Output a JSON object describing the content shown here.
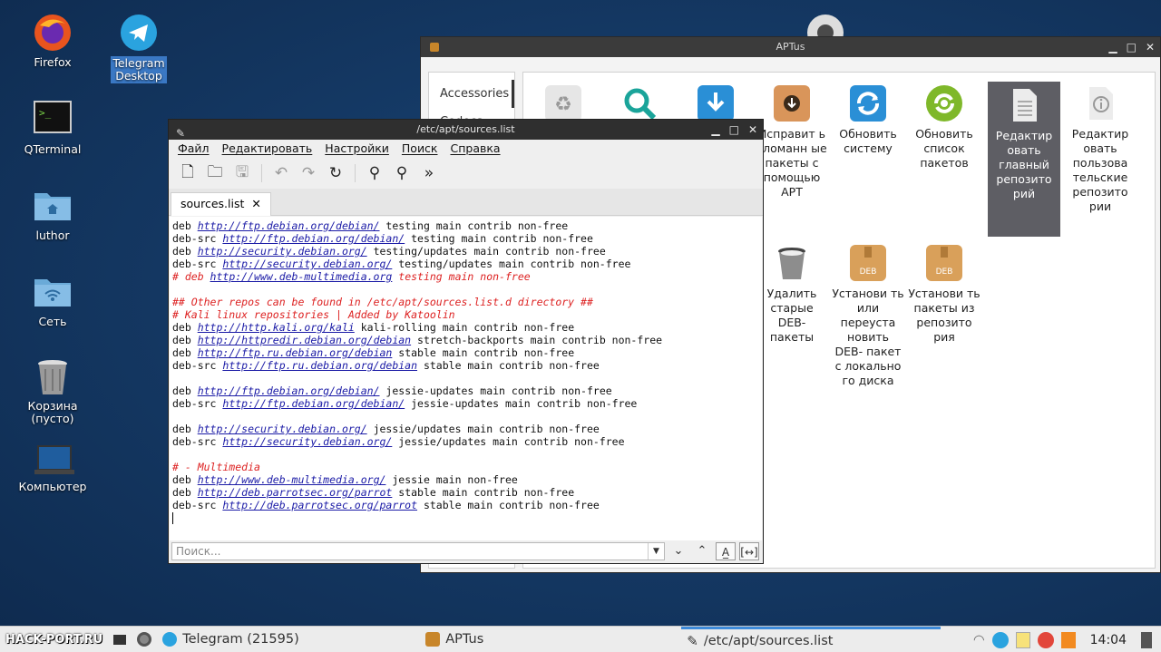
{
  "desktop": {
    "icons": [
      {
        "label": "Firefox"
      },
      {
        "label": "Telegram\nDesktop"
      },
      {
        "label": "QTerminal"
      },
      {
        "label": "luthor"
      },
      {
        "label": "Сеть"
      },
      {
        "label": "Корзина\n(пусто)"
      },
      {
        "label": "Компьютер"
      }
    ],
    "watermark": "HACK-PORT.RU"
  },
  "aptus": {
    "title": "APTus",
    "categories": [
      "Accessories",
      "Codecs"
    ],
    "apps": [
      {
        "label": "",
        "icon": "recycle-icon"
      },
      {
        "label": "",
        "icon": "search-icon"
      },
      {
        "label": "",
        "icon": "download-icon"
      },
      {
        "label": "Исправит ь сломанн ые пакеты с помощью APT",
        "icon": "fix-packages-icon"
      },
      {
        "label": "Обновить систему",
        "icon": "refresh-icon"
      },
      {
        "label": "Обновить список пакетов",
        "icon": "refresh-list-icon"
      },
      {
        "label": "Редактир овать главный репозито рий",
        "icon": "document-icon"
      },
      {
        "label": "Редактир овать пользова тельские репозито рии",
        "icon": "info-document-icon"
      },
      {
        "label": "Удалить старые DEB- пакеты",
        "icon": "trash-icon"
      },
      {
        "label": "Установи ть или переуста новить DEB- пакет с локально го диска",
        "icon": "deb-package-icon"
      },
      {
        "label": "Установи ть пакеты из репозито рия",
        "icon": "deb-package-icon"
      }
    ]
  },
  "editor": {
    "title": "/etc/apt/sources.list",
    "menu": [
      "Файл",
      "Редактировать",
      "Настройки",
      "Поиск",
      "Справка"
    ],
    "tab": "sources.list",
    "search_placeholder": "Поиск...",
    "lines": [
      {
        "t": "n",
        "pre": "deb ",
        "url": "http://ftp.debian.org/debian/",
        "post": " testing main contrib non-free"
      },
      {
        "t": "n",
        "pre": "deb-src ",
        "url": "http://ftp.debian.org/debian/",
        "post": " testing main contrib non-free"
      },
      {
        "t": "n",
        "pre": "deb ",
        "url": "http://security.debian.org/",
        "post": " testing/updates main contrib non-free"
      },
      {
        "t": "n",
        "pre": "deb-src ",
        "url": "http://security.debian.org/",
        "post": " testing/updates main contrib non-free"
      },
      {
        "t": "c",
        "pre": "# deb ",
        "url": "http://www.deb-multimedia.org",
        "post": " testing main non-free"
      },
      {
        "t": "e"
      },
      {
        "t": "c",
        "pre": "## Other repos can be found in /etc/apt/sources.list.d directory ##",
        "url": "",
        "post": ""
      },
      {
        "t": "c",
        "pre": "# Kali linux repositories | Added by Katoolin",
        "url": "",
        "post": ""
      },
      {
        "t": "n",
        "pre": "deb ",
        "url": "http://http.kali.org/kali",
        "post": " kali-rolling main contrib non-free"
      },
      {
        "t": "n",
        "pre": "deb ",
        "url": "http://httpredir.debian.org/debian",
        "post": " stretch-backports main contrib non-free"
      },
      {
        "t": "n",
        "pre": "deb ",
        "url": "http://ftp.ru.debian.org/debian",
        "post": " stable main contrib non-free"
      },
      {
        "t": "n",
        "pre": "deb-src ",
        "url": "http://ftp.ru.debian.org/debian",
        "post": " stable main contrib non-free"
      },
      {
        "t": "e"
      },
      {
        "t": "n",
        "pre": "deb ",
        "url": "http://ftp.debian.org/debian/",
        "post": " jessie-updates main contrib non-free"
      },
      {
        "t": "n",
        "pre": "deb-src ",
        "url": "http://ftp.debian.org/debian/",
        "post": " jessie-updates main contrib non-free"
      },
      {
        "t": "e"
      },
      {
        "t": "n",
        "pre": "deb ",
        "url": "http://security.debian.org/",
        "post": " jessie/updates main contrib non-free"
      },
      {
        "t": "n",
        "pre": "deb-src ",
        "url": "http://security.debian.org/",
        "post": " jessie/updates main contrib non-free"
      },
      {
        "t": "e"
      },
      {
        "t": "c",
        "pre": "# - Multimedia",
        "url": "",
        "post": ""
      },
      {
        "t": "n",
        "pre": "deb ",
        "url": "http://www.deb-multimedia.org/",
        "post": " jessie main non-free"
      },
      {
        "t": "n",
        "pre": "deb ",
        "url": "http://deb.parrotsec.org/parrot",
        "post": " stable main contrib non-free"
      },
      {
        "t": "n",
        "pre": "deb-src ",
        "url": "http://deb.parrotsec.org/parrot",
        "post": " stable main contrib non-free"
      }
    ]
  },
  "taskbar": {
    "items": [
      {
        "label": "Telegram (21595)",
        "icon": "telegram-icon"
      },
      {
        "label": "APTus",
        "icon": "aptus-icon"
      },
      {
        "label": "/etc/apt/sources.list",
        "icon": "editor-icon"
      }
    ],
    "clock": "14:04"
  },
  "colors": {
    "accent": "#3d8bdb",
    "url": "#1a1aa6",
    "comment": "#dd2222"
  }
}
